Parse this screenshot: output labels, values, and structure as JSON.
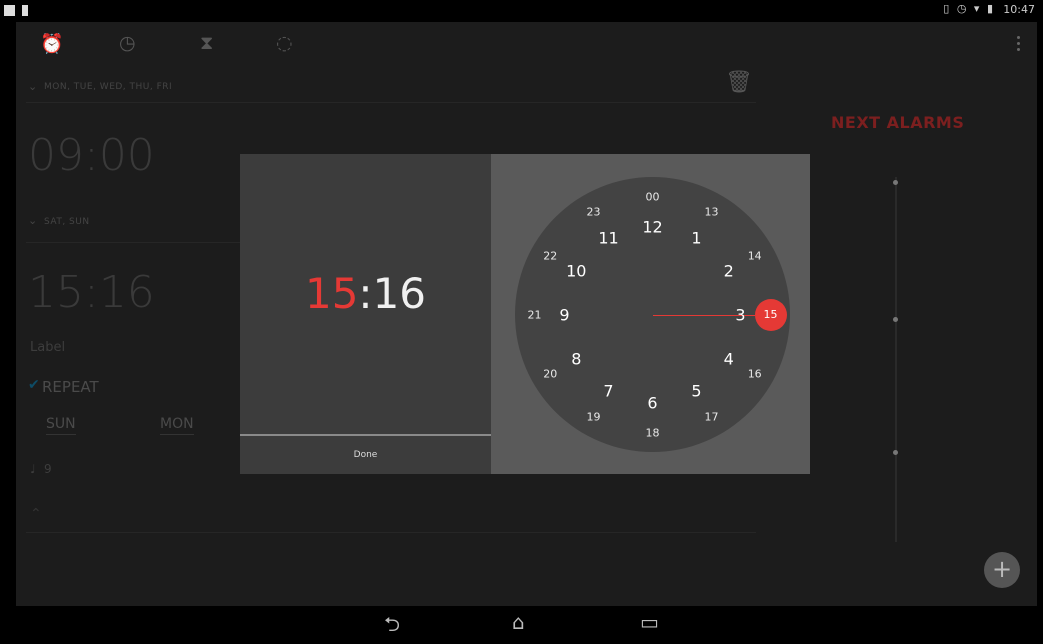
{
  "statusbar": {
    "time": "10:47"
  },
  "app": {
    "alarm1": {
      "days": "MON, TUE, WED, THU, FRI",
      "time": "09:00"
    },
    "alarm2": {
      "days": "SAT, SUN",
      "time": "15:16",
      "label": "Label",
      "repeat": "REPEAT",
      "day_sun": "SUN",
      "day_mon": "MON",
      "ringtone": "9"
    },
    "next_alarms": "NEXT ALARMS"
  },
  "dialog": {
    "hour": "15",
    "separator": ":",
    "minute": "16",
    "done_label": "Done",
    "selected_value": "15",
    "dial_outer": [
      "12",
      "1",
      "2",
      "3",
      "4",
      "5",
      "6",
      "7",
      "8",
      "9",
      "10",
      "11"
    ],
    "dial_inner": [
      "00",
      "13",
      "14",
      "15",
      "16",
      "17",
      "18",
      "19",
      "20",
      "21",
      "22",
      "23"
    ]
  },
  "colors": {
    "accent": "#e53935",
    "dialog_left": "#3c3c3c",
    "dialog_right": "#5a5a5a",
    "dial": "#434343"
  }
}
